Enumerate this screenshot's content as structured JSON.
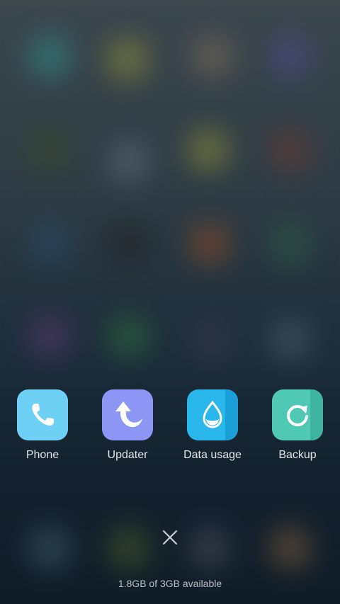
{
  "recents": {
    "apps": [
      {
        "label": "Phone",
        "icon": "phone-icon",
        "color": "#6fd0f5"
      },
      {
        "label": "Updater",
        "icon": "updater-arrow-icon",
        "color": "#8d96f4"
      },
      {
        "label": "Data usage",
        "icon": "water-drop-icon",
        "color": "#29b6ea"
      },
      {
        "label": "Backup",
        "icon": "backup-refresh-icon",
        "color": "#4fc9b4"
      }
    ]
  },
  "close_all": {
    "icon": "close-icon"
  },
  "memory": {
    "text": "1.8GB of 3GB available"
  }
}
